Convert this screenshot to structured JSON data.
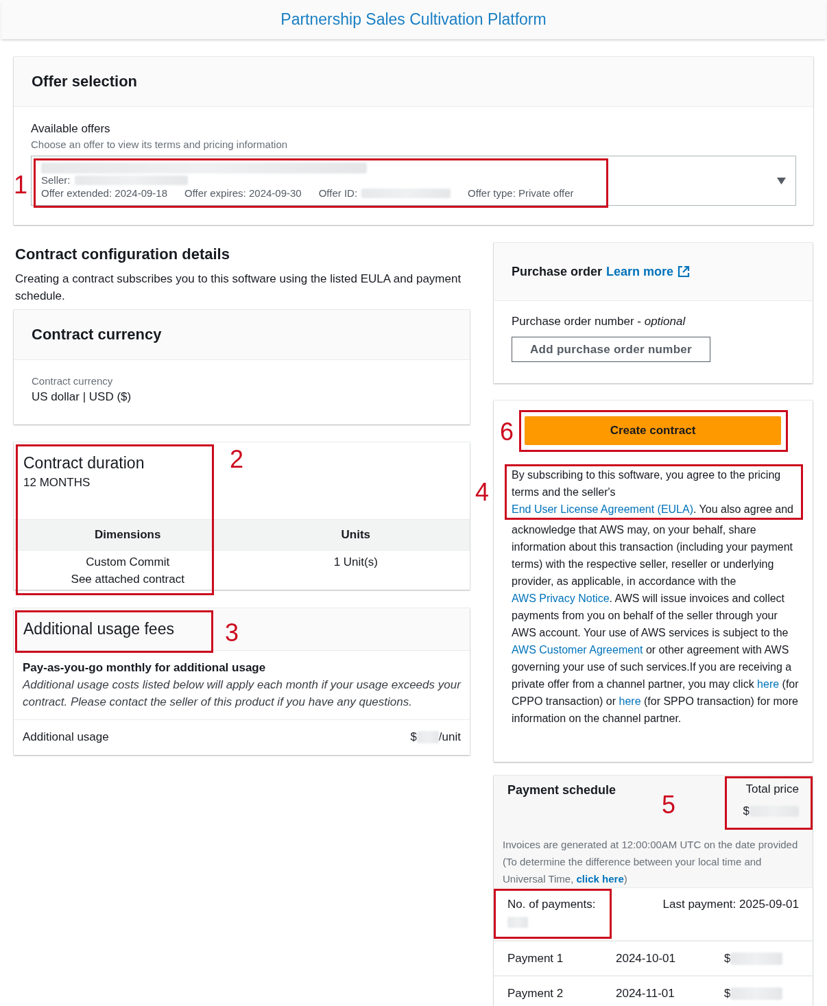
{
  "header": {
    "title": "Partnership Sales Cultivation Platform"
  },
  "offer_selection": {
    "title": "Offer selection",
    "label": "Available offers",
    "description": "Choose an offer to view its terms and pricing information",
    "selected_offer": {
      "seller_label": "Seller:",
      "offer_extended": "Offer extended: 2024-09-18",
      "offer_expires": "Offer expires: 2024-09-30",
      "offer_id_label": "Offer ID:",
      "offer_type": "Offer type: Private offer"
    }
  },
  "contract_configuration": {
    "title": "Contract configuration details",
    "description": "Creating a contract subscribes you to this software using the listed EULA and payment schedule."
  },
  "contract_currency": {
    "title": "Contract currency",
    "field_label": "Contract currency",
    "value": "US dollar | USD ($)"
  },
  "contract_duration": {
    "title": "Contract duration",
    "value": "12 MONTHS",
    "columns": [
      "Dimensions",
      "Units"
    ],
    "rows": [
      {
        "dimension": "Custom Commit",
        "note": "See attached contract",
        "units": "1 Unit(s)"
      }
    ]
  },
  "additional_usage_fees": {
    "title": "Additional usage fees",
    "subtitle": "Pay-as-you-go monthly for additional usage",
    "description": "Additional usage costs listed below will apply each month if your usage exceeds your contract. Please contact the seller of this product if you have any questions.",
    "rows": [
      {
        "label": "Additional usage",
        "price_prefix": "$",
        "price_suffix": "/unit"
      }
    ]
  },
  "purchase_order": {
    "title": "Purchase order",
    "link": "Learn more",
    "field_label": "Purchase order number - *optional*",
    "button": "Add purchase order number"
  },
  "create_contract": {
    "button": "Create contract",
    "terms": [
      {
        "kind": "text",
        "text": "By subscribing to this software, you agree to the pricing terms and the seller's "
      },
      {
        "kind": "link",
        "text": "End User License Agreement (EULA)"
      },
      {
        "kind": "text",
        "text": ". You also agree and"
      },
      {
        "kind": "break"
      },
      {
        "kind": "text",
        "text": "acknowledge that AWS may, on your behalf, share information about this transaction (including your payment terms) with the respective seller, reseller or underlying provider, as applicable, in accordance with the "
      },
      {
        "kind": "link",
        "text": "AWS Privacy Notice"
      },
      {
        "kind": "text",
        "text": ". AWS will issue invoices and collect payments from you on behalf of the seller through your AWS account. Your use of AWS services is subject to the "
      },
      {
        "kind": "link",
        "text": "AWS Customer Agreement"
      },
      {
        "kind": "text",
        "text": " or other agreement with AWS governing your use of such services.If you are receiving a private offer from a channel partner, you may click "
      },
      {
        "kind": "link",
        "text": "here"
      },
      {
        "kind": "text",
        "text": " (for CPPO transaction) or "
      },
      {
        "kind": "link",
        "text": "here"
      },
      {
        "kind": "text",
        "text": " (for SPPO transaction) for more information on the channel partner."
      }
    ]
  },
  "payment_schedule": {
    "title": "Payment schedule",
    "total_label": "Total price",
    "total_prefix": "$",
    "note": [
      {
        "kind": "text",
        "text": "Invoices are generated at 12:00:00AM UTC on the date provided (To determine the difference between your local time and Universal Time, "
      },
      {
        "kind": "link",
        "text": "click here"
      },
      {
        "kind": "text",
        "text": ")"
      }
    ],
    "count_label": "No. of payments:",
    "last_payment": "Last payment: 2025-09-01",
    "payments": [
      {
        "label": "Payment 1",
        "date": "2024-10-01",
        "amount_prefix": "$"
      },
      {
        "label": "Payment 2",
        "date": "2024-11-01",
        "amount_prefix": "$"
      }
    ]
  },
  "annotations": [
    {
      "kind": "numbered",
      "number": "1"
    },
    {
      "kind": "numbered",
      "number": "2"
    },
    {
      "kind": "numbered",
      "number": "3"
    },
    {
      "kind": "numbered",
      "number": "4"
    },
    {
      "kind": "numbered",
      "number": "5"
    },
    {
      "kind": "numbered",
      "number": "6"
    },
    {
      "kind": "unnumbered"
    }
  ]
}
